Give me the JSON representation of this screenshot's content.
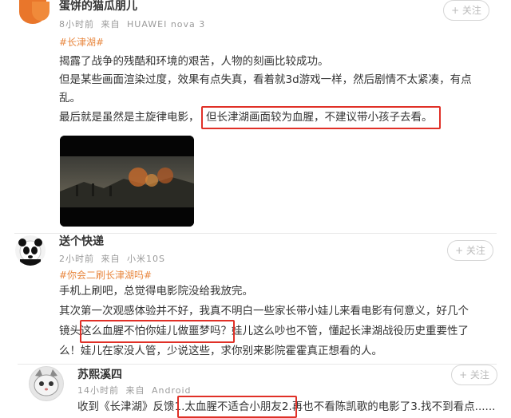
{
  "post1": {
    "nickname": "蛋饼的猫瓜朋儿",
    "time": "8小时前",
    "source_label": "来自",
    "device": "HUAWEI nova 3",
    "follow_label": "+ 关注",
    "topic": "#长津湖#",
    "lines": [
      "揭露了战争的残酷和环境的艰苦，人物的刻画比较成功。",
      "但是某些画面渲染过度，效果有点失真，看着就3d游戏一样，然后剧情不太紧凑，有点",
      "乱。"
    ],
    "last_line_plain": "最后就是虽然是主旋律电影，",
    "last_line_boxed": "但长津湖画面较为血腥，不建议带小孩子去看。"
  },
  "post2": {
    "nickname": "送个快递",
    "time": "2小时前",
    "source_label": "来自",
    "device": "小米10S",
    "follow_label": "+ 关注",
    "topic": "#你会二刷长津湖吗#",
    "line1": "手机上刷吧，总觉得电影院没给我放完。",
    "line2": "其次第一次观感体验并不好，我真不明白一些家长带小娃儿来看电影有何意义，好几个",
    "line3_pre": "镜头",
    "line3_boxed": "这么血腥不怕你娃儿做噩梦吗？",
    "line3_post": "娃儿这么吵也不管，懂起长津湖战役历史重要性了",
    "line4": "么！娃儿在家没人管，少说这些，求你别来影院霍霍真正想看的人。"
  },
  "post3": {
    "nickname": "苏熙溪四",
    "time": "14小时前",
    "source_label": "来自",
    "device": "Android",
    "follow_label": "+ 关注",
    "line_pre": "收到《长津湖》反馈",
    "line_boxed": "1.太血腥不适合小朋友",
    "line_post": "2.再也不看陈凯歌的电影了3.找不到看点......"
  },
  "colors": {
    "highlight_box": "#e03027",
    "topic": "#e8873f",
    "meta": "#9a9a9a"
  }
}
